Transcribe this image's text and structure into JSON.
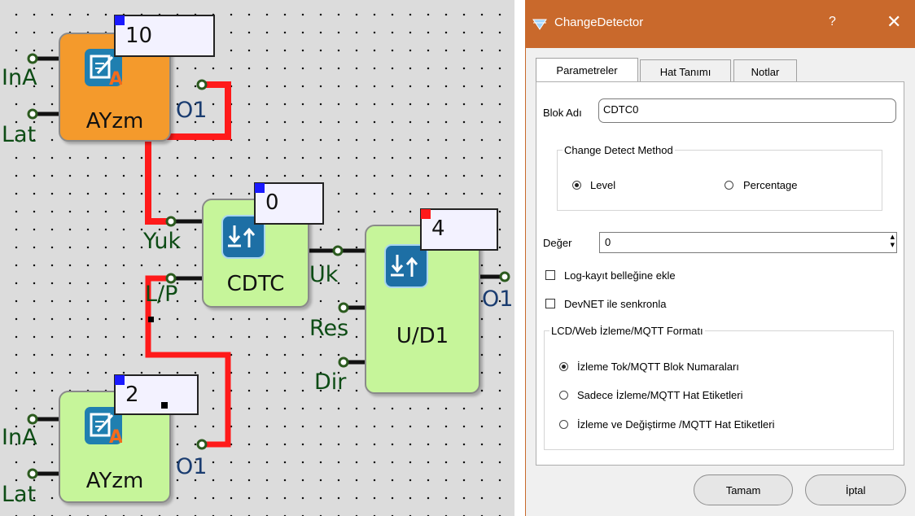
{
  "canvas": {
    "blocks": {
      "ayzm_top": {
        "name": "AYzm",
        "number": "10",
        "inputs": [
          "InA",
          "Lat"
        ],
        "output": "O1"
      },
      "cdtc": {
        "name": "CDTC",
        "number": "0",
        "inputs": [
          "Yuk",
          "L/P"
        ],
        "output": "Uk"
      },
      "updown": {
        "name": "U/D1",
        "number": "4",
        "inputs": [
          "Res",
          "Dir"
        ],
        "output": "O1"
      },
      "ayzm_bottom": {
        "name": "AYzm",
        "number": "2",
        "inputs": [
          "InA",
          "Lat"
        ],
        "output": "O1"
      }
    },
    "colors": {
      "wire_active": "#ff1a1a",
      "wire": "#111111",
      "block_orange": "#f49a2c",
      "block_green": "#c6f59a",
      "flag_blue": "#1a19ff",
      "flag_red": "#ff1a1a"
    }
  },
  "dialog": {
    "title": "ChangeDetector",
    "help_label": "?",
    "close_label": "✕",
    "tabs": [
      "Parametreler",
      "Hat Tanımı",
      "Notlar"
    ],
    "block_name_label": "Blok Adı",
    "block_name_value": "CDTC0",
    "method_group": {
      "legend": "Change Detect Method",
      "options": [
        {
          "label": "Level",
          "selected": true
        },
        {
          "label": "Percentage",
          "selected": false
        }
      ]
    },
    "value_label": "Değer",
    "value": "0",
    "log_checkbox": {
      "label": "Log-kayıt belleğine ekle",
      "checked": false
    },
    "devnet_checkbox": {
      "label": "DevNET ile senkronla",
      "checked": false
    },
    "format_group": {
      "legend": "LCD/Web İzleme/MQTT Formatı",
      "options": [
        {
          "label": "İzleme Tok/MQTT Blok Numaraları",
          "selected": true
        },
        {
          "label": "Sadece İzleme/MQTT Hat Etiketleri",
          "selected": false
        },
        {
          "label": "İzleme ve Değiştirme /MQTT Hat Etiketleri",
          "selected": false
        }
      ]
    },
    "ok_label": "Tamam",
    "cancel_label": "İptal",
    "colors": {
      "titlebar": "#c9692c"
    }
  }
}
